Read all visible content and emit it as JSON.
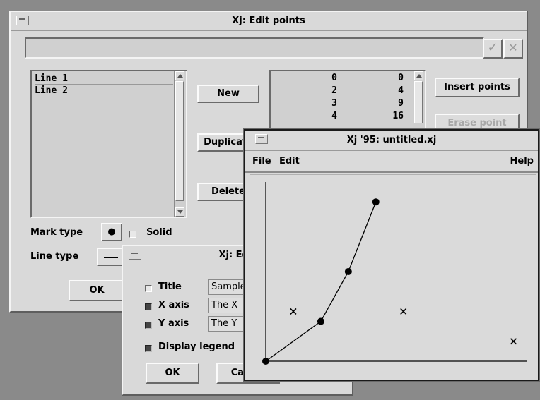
{
  "edit_points_window": {
    "title": "Xj: Edit points",
    "lines_list": [
      "Line 1",
      "Line 2"
    ],
    "new_label": "New",
    "duplicate_label": "Duplicate",
    "delete_label": "Delete",
    "points": [
      {
        "x": "0",
        "y": "0"
      },
      {
        "x": "2",
        "y": "4"
      },
      {
        "x": "3",
        "y": "9"
      },
      {
        "x": "4",
        "y": "16"
      }
    ],
    "insert_points_label": "Insert points",
    "erase_point_label": "Erase point",
    "mark_type_label": "Mark type",
    "mark_type_value": "●",
    "solid_label": "Solid",
    "solid_checked": false,
    "line_type_label": "Line type",
    "ok_label": "OK",
    "accept_icon": "check-icon",
    "cancel_icon": "x-icon"
  },
  "edit_graph_window": {
    "title": "Xj: Edit",
    "title_label": "Title",
    "title_checked": false,
    "title_value": "Sample",
    "x_axis_label": "X axis",
    "x_axis_checked": true,
    "x_axis_value": "The X",
    "y_axis_label": "Y axis",
    "y_axis_checked": true,
    "y_axis_value": "The Y",
    "display_legend_label": "Display legend",
    "display_legend_checked": true,
    "ok_label": "OK",
    "cancel_label": "Cancel"
  },
  "main_window": {
    "title": "Xj '95: untitled.xj",
    "menu": {
      "file": "File",
      "edit": "Edit",
      "help": "Help"
    }
  },
  "chart_data": {
    "type": "scatter",
    "series": [
      {
        "marker": "filled-circle",
        "connected": true,
        "points": [
          [
            0,
            0
          ],
          [
            2,
            4
          ],
          [
            3,
            9
          ],
          [
            4,
            16
          ]
        ]
      },
      {
        "marker": "x",
        "connected": false,
        "points": [
          [
            1,
            5
          ],
          [
            5,
            5
          ],
          [
            9,
            2
          ]
        ]
      }
    ],
    "xlim": [
      0,
      9.5
    ],
    "ylim": [
      0,
      18
    ],
    "title": "",
    "xlabel": "",
    "ylabel": "",
    "grid": false
  }
}
